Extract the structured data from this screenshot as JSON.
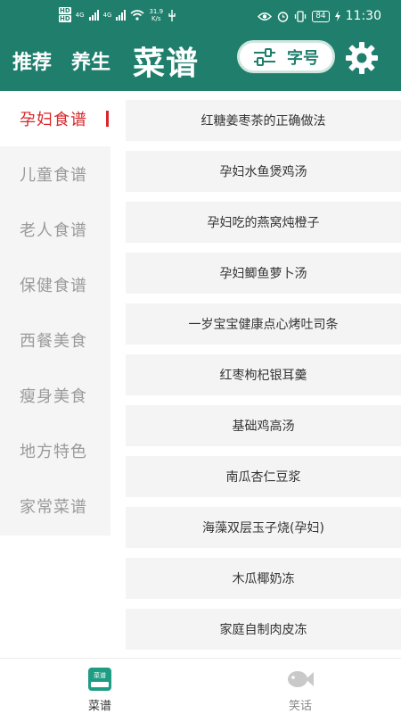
{
  "status_bar": {
    "hd1": "HD",
    "hd2": "HD",
    "net1": "4G",
    "net2": "4G",
    "speed_value": "31.9",
    "speed_unit": "K/s",
    "battery": "84",
    "time": "11:30"
  },
  "header": {
    "nav_recommend": "推荐",
    "nav_health": "养生",
    "title": "菜谱",
    "font_button_label": "字号",
    "colors": {
      "header_bg": "#1f7f6c",
      "accent_red": "#d9262b"
    }
  },
  "sidebar": {
    "items": [
      {
        "label": "孕妇食谱",
        "active": true
      },
      {
        "label": "儿童食谱"
      },
      {
        "label": "老人食谱"
      },
      {
        "label": "保健食谱"
      },
      {
        "label": "西餐美食"
      },
      {
        "label": "瘦身美食"
      },
      {
        "label": "地方特色"
      },
      {
        "label": "家常菜谱"
      }
    ]
  },
  "recipes": [
    "红糖姜枣茶的正确做法",
    "孕妇水鱼煲鸡汤",
    "孕妇吃的燕窝炖橙子",
    "孕妇鲫鱼萝卜汤",
    "一岁宝宝健康点心烤吐司条",
    "红枣枸杞银耳羹",
    "基础鸡高汤",
    "南瓜杏仁豆浆",
    "海藻双层玉子烧(孕妇)",
    "木瓜椰奶冻",
    "家庭自制肉皮冻"
  ],
  "bottom_nav": {
    "recipes_icon_text": "菜谱",
    "recipes_label": "菜谱",
    "jokes_label": "笑话",
    "icons": {
      "recipes": "recipe-book-icon",
      "jokes": "fish-icon"
    }
  }
}
